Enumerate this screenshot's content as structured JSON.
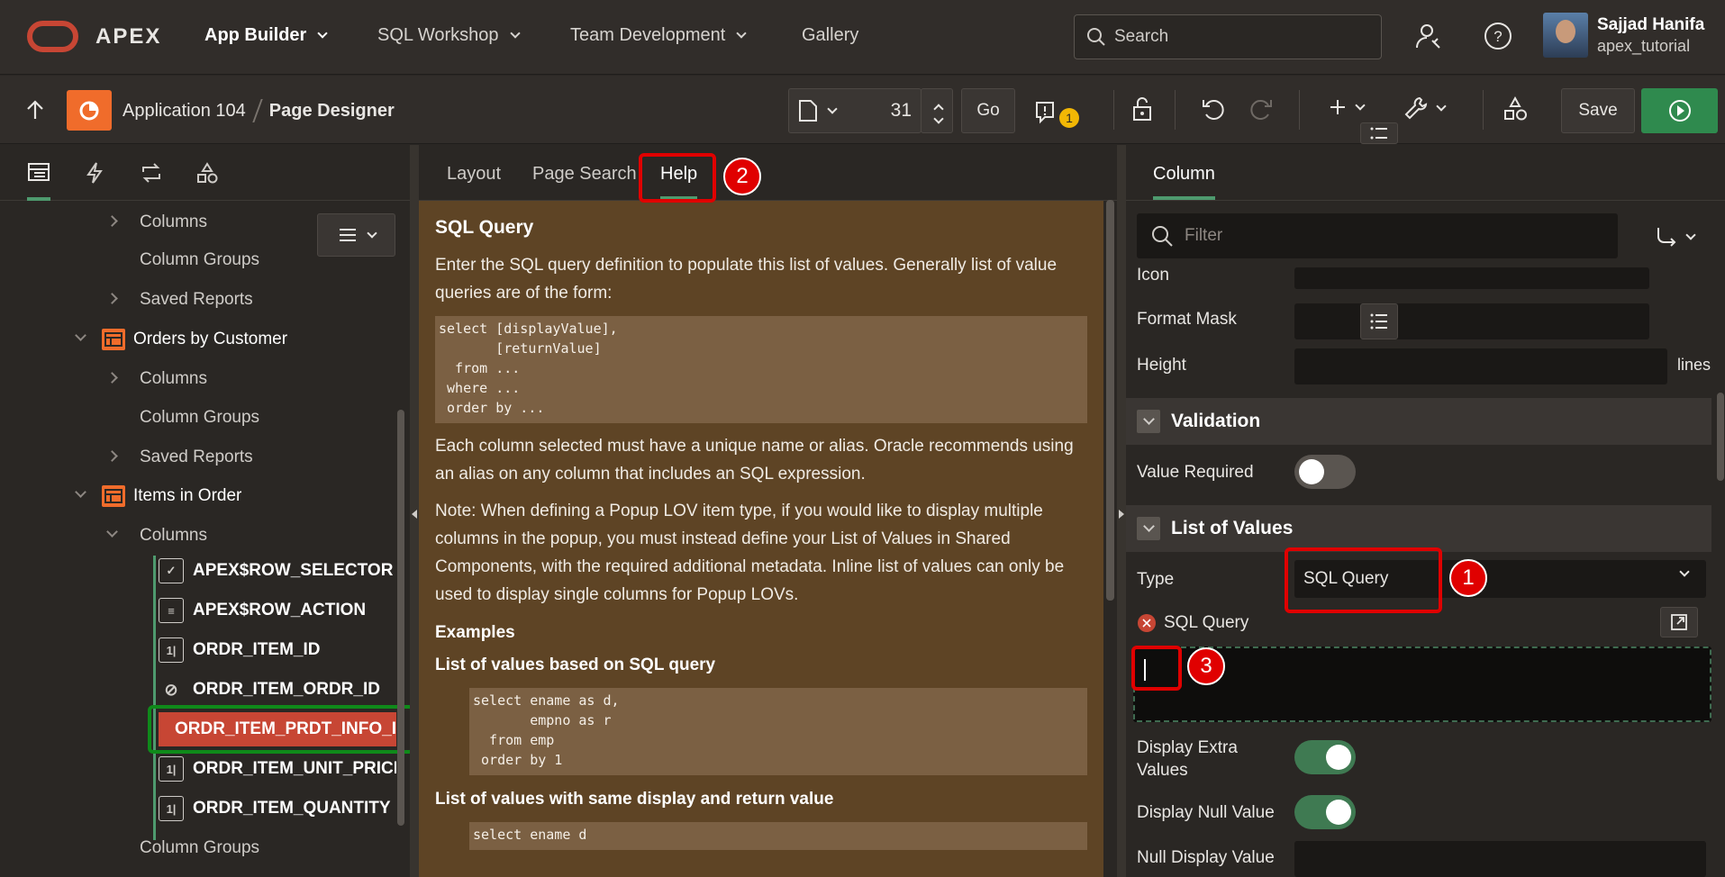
{
  "topbar": {
    "brand": "APEX",
    "nav": [
      {
        "label": "App Builder",
        "active": true
      },
      {
        "label": "SQL Workshop",
        "active": false
      },
      {
        "label": "Team Development",
        "active": false
      },
      {
        "label": "Gallery",
        "active": false
      }
    ],
    "search_placeholder": "Search",
    "user": {
      "name": "Sajjad Hanifa",
      "username": "apex_tutorial"
    }
  },
  "toolbar": {
    "app": "Application 104",
    "page": "Page Designer",
    "page_number": "31",
    "go_label": "Go",
    "notification_count": "1",
    "save_label": "Save"
  },
  "left": {
    "tree": [
      {
        "label": "Columns",
        "expandable": true
      },
      {
        "label": "Column Groups",
        "expandable": false
      },
      {
        "label": "Saved Reports",
        "expandable": true
      },
      {
        "label": "Orders by Customer",
        "expandable": true,
        "expanded": true,
        "region": true
      },
      {
        "label": "Columns",
        "expandable": true
      },
      {
        "label": "Column Groups",
        "expandable": false
      },
      {
        "label": "Saved Reports",
        "expandable": true
      },
      {
        "label": "Items in Order",
        "expandable": true,
        "expanded": true,
        "region": true
      },
      {
        "label": "Columns",
        "expandable": true,
        "expanded": true
      }
    ],
    "columns": [
      {
        "label": "APEX$ROW_SELECTOR",
        "icon": "checkbox-icon"
      },
      {
        "label": "APEX$ROW_ACTION",
        "icon": "clipboard-icon"
      },
      {
        "label": "ORDR_ITEM_ID",
        "icon": "number-field-icon"
      },
      {
        "label": "ORDR_ITEM_ORDR_ID",
        "icon": "hidden-eye-icon"
      },
      {
        "label": "ORDR_ITEM_PRDT_INFO_ID",
        "icon": "error-x-icon",
        "selected": true
      },
      {
        "label": "ORDR_ITEM_UNIT_PRICE",
        "icon": "number-field-icon"
      },
      {
        "label": "ORDR_ITEM_QUANTITY",
        "icon": "number-field-icon"
      }
    ],
    "footer_item": "Column Groups"
  },
  "middle": {
    "tabs": [
      "Layout",
      "Page Search",
      "Help"
    ],
    "active_tab": "Help",
    "help": {
      "title": "SQL Query",
      "intro": "Enter the SQL query definition to populate this list of values. Generally list of value queries are of the form:",
      "code1": "select [displayValue],\n       [returnValue]\n  from ...\n where ...\n order by ...",
      "para2": "Each column selected must have a unique name or alias. Oracle recommends using an alias on any column that includes an SQL expression.",
      "para3": "Note: When defining a Popup LOV item type, if you would like to display multiple columns in the popup, you must instead define your List of Values in Shared Components, with the required additional metadata. Inline list of values can only be used to display single columns for Popup LOVs.",
      "examples_heading": "Examples",
      "ex1_heading": "List of values based on SQL query",
      "ex1_code": "select ename as d,\n       empno as r\n  from emp\n order by 1",
      "ex2_heading": "List of values with same display and return value",
      "ex2_code": "select ename d"
    }
  },
  "right": {
    "tab": "Column",
    "filter_placeholder": "Filter",
    "props": {
      "icon_label": "Icon",
      "format_mask_label": "Format Mask",
      "height_label": "Height",
      "height_unit": "lines",
      "validation_heading": "Validation",
      "value_required_label": "Value Required",
      "value_required": false,
      "lov_heading": "List of Values",
      "type_label": "Type",
      "type_value": "SQL Query",
      "sql_query_label": "SQL Query",
      "display_extra_label": "Display Extra Values",
      "display_extra": true,
      "display_null_label": "Display Null Value",
      "display_null": true,
      "null_display_label": "Null Display Value"
    }
  },
  "annotations": {
    "badge1": "1",
    "badge2": "2",
    "badge3": "3"
  },
  "colors": {
    "accent_green": "#4e9a6e",
    "run_green": "#2f8a4e",
    "error_red": "#c74634",
    "annotation_red": "#e00000",
    "help_bg": "#5e4425"
  }
}
